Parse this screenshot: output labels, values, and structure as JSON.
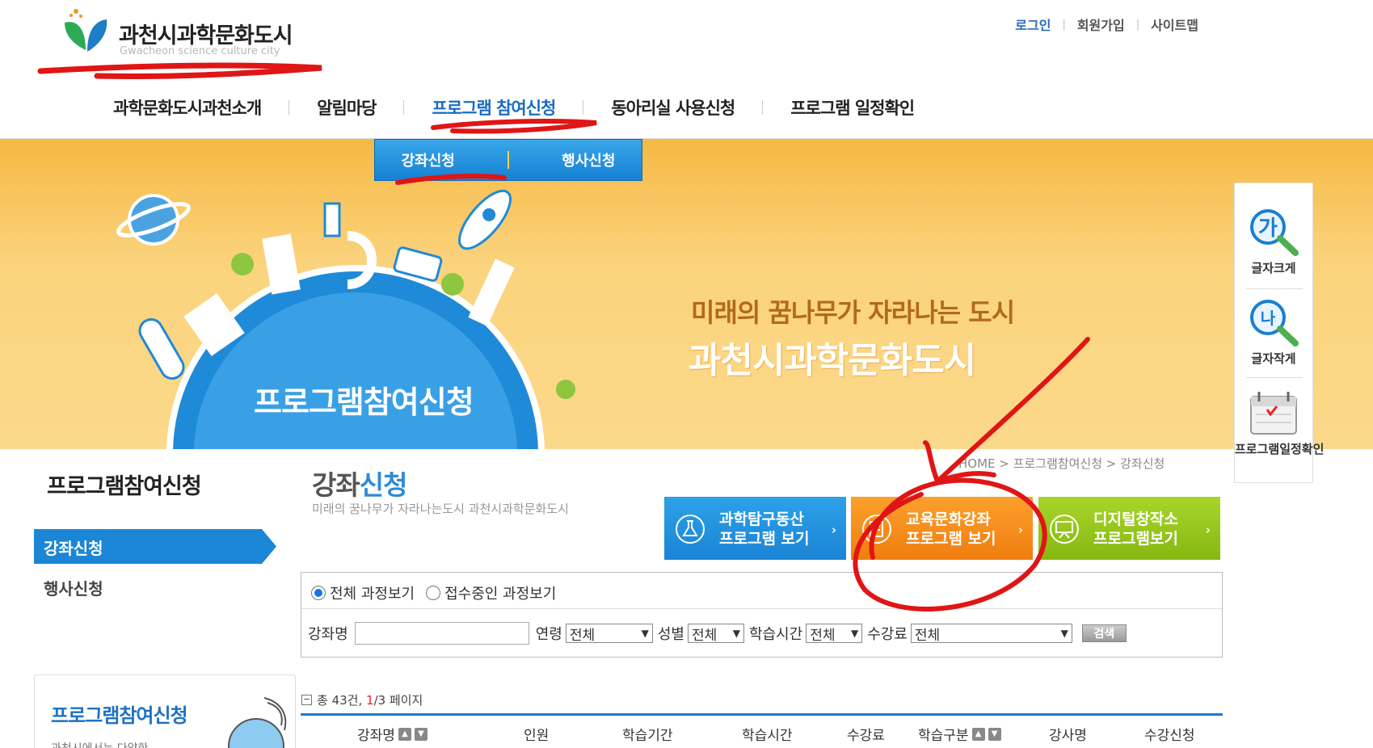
{
  "header": {
    "logo_title": "과천시과학문화도시",
    "logo_sub": "Gwacheon science culture city",
    "util_links": [
      "로그인",
      "회원가입",
      "사이트맵"
    ],
    "gnb": [
      "과학문화도시과천소개",
      "알림마당",
      "프로그램 참여신청",
      "동아리실 사용신청",
      "프로그램 일정확인"
    ],
    "submenu": [
      "강좌신청",
      "행사신청"
    ]
  },
  "banner": {
    "title": "프로그램참여신청",
    "slogan1": "미래의 꿈나무가 자라나는 도시",
    "slogan2": "과천시과학문화도시"
  },
  "quick": {
    "zoom_in_glyph": "가",
    "zoom_in_label": "글자크게",
    "zoom_out_glyph": "나",
    "zoom_out_label": "글자작게",
    "schedule_label": "프로그램일정확인"
  },
  "sidebar": {
    "title": "프로그램참여신청",
    "items": [
      "강좌신청",
      "행사신청"
    ],
    "promo_title": "프로그램참여신청",
    "promo_sub": "과천시에서는 다양한"
  },
  "main": {
    "title_a": "강좌",
    "title_b": "신청",
    "subtitle": "미래의 꿈나무가 자라나는도시 과천시과학문화도시",
    "breadcrumb": "HOME > 프로그램참여신청 > 강좌신청",
    "categories": [
      {
        "line1": "과학탐구동산",
        "line2": "프로그램 보기"
      },
      {
        "line1": "교육문화강좌",
        "line2": "프로그램 보기"
      },
      {
        "line1": "디지털창작소",
        "line2": "프로그램보기"
      }
    ],
    "filter": {
      "radio_all": "전체 과정보기",
      "radio_open": "접수중인 과정보기",
      "course_label": "강좌명",
      "age_label": "연령",
      "age_value": "전체",
      "gender_label": "성별",
      "gender_value": "전체",
      "time_label": "학습시간",
      "time_value": "전체",
      "fee_label": "수강료",
      "fee_value": "전체",
      "search_button": "검색"
    },
    "count": {
      "prefix": "총 43건,",
      "current_page": "1",
      "suffix": "/3 페이지"
    },
    "columns": [
      "강좌명",
      "인원",
      "학습기간",
      "학습시간",
      "수강료",
      "학습구분",
      "강사명",
      "수강신청"
    ]
  },
  "colors": {
    "accent_blue": "#1a7ed0",
    "banner_yellow": "#f8c55a",
    "annotation_red": "#e01515"
  }
}
